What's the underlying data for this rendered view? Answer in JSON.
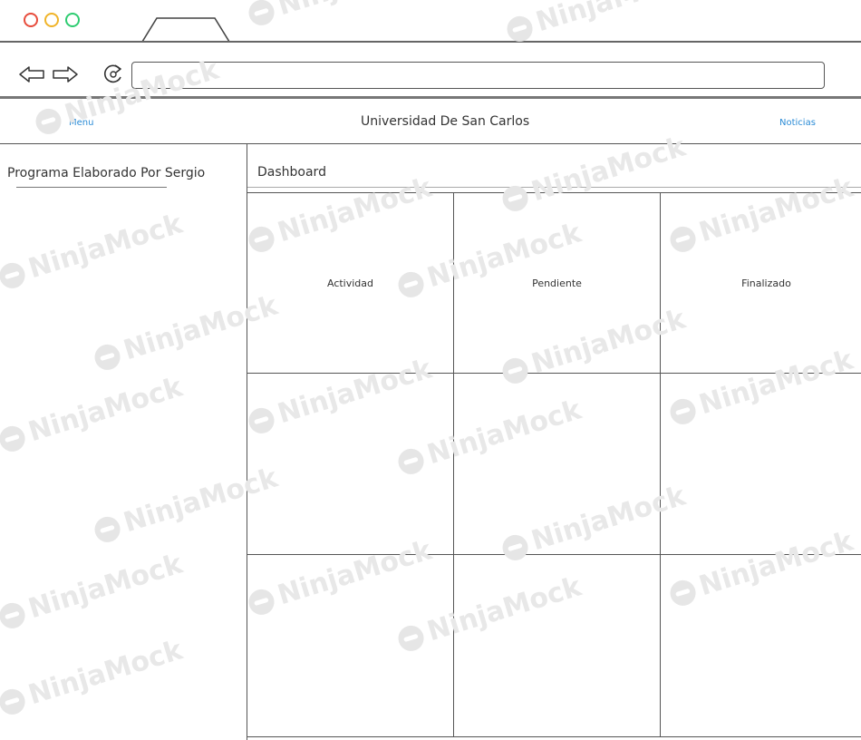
{
  "browser": {
    "traffic_light_colors": [
      "#e74c3c",
      "#f0b429",
      "#2ecc71"
    ],
    "back_icon": "arrow-left-icon",
    "forward_icon": "arrow-right-icon",
    "reload_icon": "reload-icon",
    "url_value": ""
  },
  "header": {
    "menu_label": "Menu",
    "title": "Universidad De San Carlos",
    "news_label": "Noticias",
    "link_color": "#2a8bd6"
  },
  "sidebar": {
    "title": "Programa Elaborado Por Sergio"
  },
  "main": {
    "title": "Dashboard",
    "grid": [
      [
        "Actividad",
        "Pendiente",
        "Finalizado"
      ],
      [
        "",
        "",
        ""
      ],
      [
        "",
        "",
        ""
      ]
    ]
  },
  "watermark": {
    "text": "NinjaMock"
  }
}
